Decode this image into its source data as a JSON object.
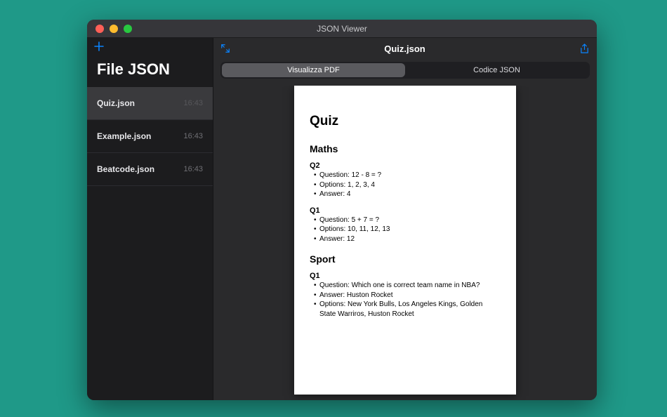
{
  "window": {
    "title": "JSON Viewer"
  },
  "sidebar": {
    "title": "File JSON",
    "files": [
      {
        "name": "Quiz.json",
        "time": "16:43",
        "selected": true
      },
      {
        "name": "Example.json",
        "time": "16:43",
        "selected": false
      },
      {
        "name": "Beatcode.json",
        "time": "16:43",
        "selected": false
      }
    ]
  },
  "main": {
    "doc_title": "Quiz.json",
    "segments": {
      "pdf": "Visualizza PDF",
      "json": "Codice JSON"
    }
  },
  "page": {
    "title": "Quiz",
    "section1_title": "Maths",
    "q2_title": "Q2",
    "q2_question": "Question: 12 - 8 = ?",
    "q2_options": "Options: 1, 2, 3, 4",
    "q2_answer": "Answer: 4",
    "q1_title": "Q1",
    "q1_question": "Question: 5 + 7 = ?",
    "q1_options": "Options: 10, 11, 12, 13",
    "q1_answer": "Answer: 12",
    "section2_title": "Sport",
    "sport_q1_title": "Q1",
    "sport_q1_question": "Question: Which one is correct team name in NBA?",
    "sport_q1_answer": "Answer: Huston Rocket",
    "sport_q1_options": "Options: New York Bulls, Los Angeles Kings, Golden State Warriros, Huston Rocket"
  }
}
